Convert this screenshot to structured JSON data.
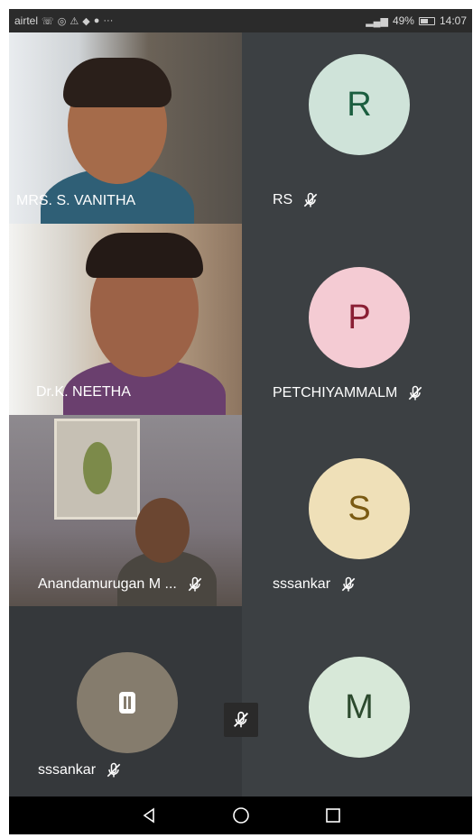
{
  "status_bar": {
    "carrier": "airtel",
    "signal_text": "49%",
    "time": "14:07",
    "icons": [
      "call-icon",
      "data-icon",
      "warning-icon",
      "app-icon",
      "chat-icon",
      "more-icon"
    ]
  },
  "participants": [
    {
      "name": "MRS. S. VANITHA",
      "type": "video",
      "muted": false
    },
    {
      "name": "RS",
      "type": "avatar",
      "initial": "R",
      "avatar_color": "#cfe3d9",
      "text_color": "#1b5e3f",
      "muted": true
    },
    {
      "name": "Dr.K. NEETHA",
      "type": "video",
      "muted": false
    },
    {
      "name": "PETCHIYAMMALM",
      "type": "avatar",
      "initial": "P",
      "avatar_color": "#f4cbd3",
      "text_color": "#8a1f34",
      "muted": true
    },
    {
      "name": "Anandamurugan M ...",
      "type": "video",
      "muted": true
    },
    {
      "name": "sssankar",
      "type": "avatar",
      "initial": "S",
      "avatar_color": "#efe0b8",
      "text_color": "#7a5a12",
      "muted": true
    },
    {
      "name": "sssankar",
      "type": "self",
      "muted": true
    },
    {
      "name": "",
      "type": "avatar",
      "initial": "M",
      "avatar_color": "#d7e8d8",
      "text_color": "#2c4a2e",
      "muted": false
    }
  ],
  "navigation": {
    "buttons": [
      "back-icon",
      "home-icon",
      "recents-icon"
    ]
  }
}
